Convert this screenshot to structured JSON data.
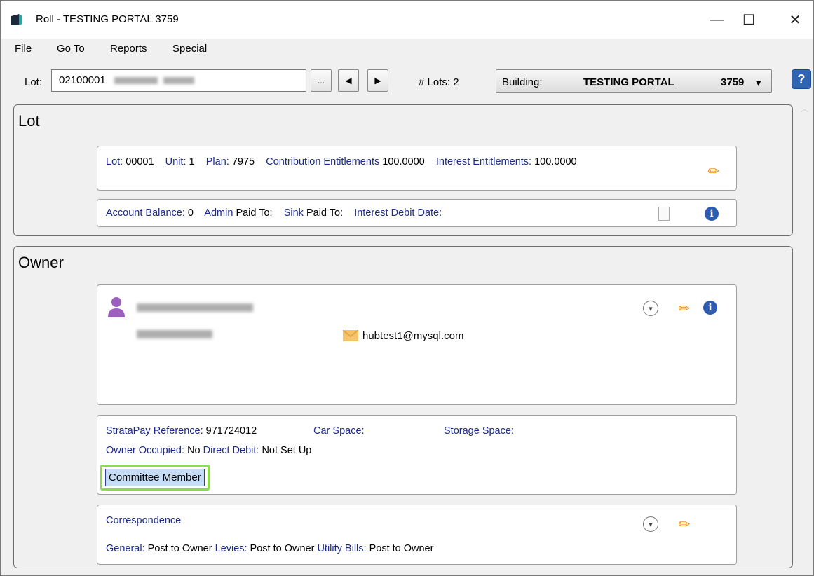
{
  "window": {
    "title": "Roll - TESTING PORTAL 3759",
    "minimize": "—",
    "maximize": "☐",
    "close": "✕"
  },
  "menu": [
    "File",
    "Go To",
    "Reports",
    "Special"
  ],
  "toolbar": {
    "lot_label": "Lot:",
    "lot_value": "02100001",
    "ellipsis": "...",
    "prev": "◀",
    "next": "▶",
    "lots_count": "# Lots: 2",
    "building_label": "Building:",
    "building_name": "TESTING PORTAL",
    "building_number": "3759",
    "dropdown_arrow": "▾",
    "help": "?"
  },
  "lot_panel": {
    "title": "Lot",
    "details": [
      {
        "label": "Lot:",
        "value": "00001"
      },
      {
        "label": "Unit:",
        "value": "1"
      },
      {
        "label": "Plan:",
        "value": "7975"
      },
      {
        "label": "Contribution Entitlements",
        "value": "100.0000"
      },
      {
        "label": "Interest Entitlements:",
        "value": "100.0000"
      }
    ],
    "account": [
      {
        "label": "Account Balance:",
        "value": "0"
      },
      {
        "label": "Admin",
        "value": "Paid To:"
      },
      {
        "label": "Sink",
        "value": "Paid To:"
      },
      {
        "label": "Interest Debit Date:",
        "value": ""
      }
    ]
  },
  "owner_panel": {
    "title": "Owner",
    "email": "hubtest1@mysql.com",
    "strata_label": "StrataPay Reference:",
    "strata_value": "971724012",
    "car_space_label": "Car Space:",
    "storage_label": "Storage Space:",
    "owner_occupied_label": "Owner Occupied:",
    "owner_occupied_value": "No",
    "direct_debit_label": "Direct Debit:",
    "direct_debit_value": "Not Set Up",
    "committee_button": "Committee Member",
    "correspondence_title": "Correspondence",
    "correspondence": [
      {
        "label": "General:",
        "value": "Post to Owner"
      },
      {
        "label": "Levies:",
        "value": "Post to Owner"
      },
      {
        "label": "Utility Bills:",
        "value": "Post to Owner"
      }
    ]
  },
  "icons": {
    "pencil": "edit-icon",
    "info": "info-icon",
    "chevron": "chevron-down-icon",
    "email": "email-icon",
    "document": "document-icon",
    "person": "person-icon"
  },
  "colors": {
    "label_blue": "#1c2a8c",
    "info_blue": "#2f5cb3",
    "pencil_orange": "#e08a1a",
    "person_purple": "#9b5fc0",
    "highlight_green": "#8bdb4c"
  }
}
